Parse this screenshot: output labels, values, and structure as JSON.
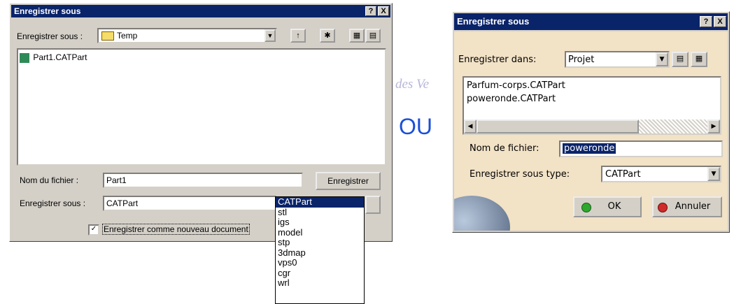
{
  "dialog1": {
    "title": "Enregistrer sous",
    "help": "?",
    "close": "X",
    "save_in_label": "Enregistrer sous :",
    "save_in_value": "Temp",
    "files": [
      "Part1.CATPart"
    ],
    "filename_label": "Nom du fichier :",
    "filename_value": "Part1",
    "save_button": "Enregistrer",
    "type_label": "Enregistrer sous :",
    "type_value": "CATPart",
    "checkbox_label": "Enregistrer comme nouveau document",
    "checkbox_checked": true,
    "type_options": [
      "CATPart",
      "stl",
      "igs",
      "model",
      "stp",
      "3dmap",
      "vps0",
      "cgr",
      "wrl"
    ]
  },
  "separator_text": "OU",
  "watermark_text": "des Ve",
  "dialog2": {
    "title": "Enregistrer sous",
    "help": "?",
    "close": "X",
    "save_in_label": "Enregistrer dans:",
    "save_in_value": "Projet",
    "files": [
      "Parfum-corps.CATPart",
      "poweronde.CATPart"
    ],
    "filename_label": "Nom de fichier:",
    "filename_value": "poweronde",
    "type_label": "Enregistrer sous type:",
    "type_value": "CATPart",
    "ok_button": "OK",
    "cancel_button": "Annuler"
  }
}
